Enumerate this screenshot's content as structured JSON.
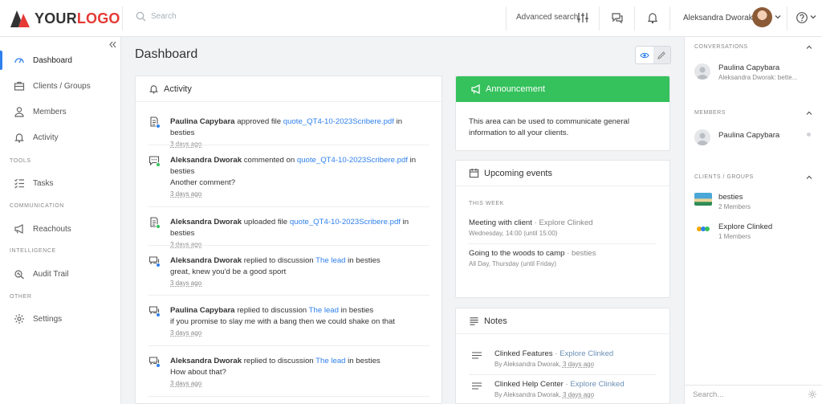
{
  "logo": {
    "part1": "YOUR",
    "part2": "LOGO"
  },
  "header": {
    "search_placeholder": "Search",
    "advanced_search": "Advanced search",
    "user_name": "Aleksandra Dworak"
  },
  "sidebar": {
    "items": [
      {
        "label": "Dashboard",
        "icon": "speedometer-icon"
      },
      {
        "label": "Clients / Groups",
        "icon": "briefcase-icon"
      },
      {
        "label": "Members",
        "icon": "user-icon"
      },
      {
        "label": "Activity",
        "icon": "bell-icon"
      },
      {
        "label": "Tasks",
        "icon": "checklist-icon"
      },
      {
        "label": "Reachouts",
        "icon": "megaphone-icon"
      },
      {
        "label": "Audit Trail",
        "icon": "audit-icon"
      },
      {
        "label": "Settings",
        "icon": "gear-icon"
      }
    ],
    "sections": [
      "TOOLS",
      "COMMUNICATION",
      "INTELLIGENCE",
      "OTHER"
    ]
  },
  "main": {
    "title": "Dashboard",
    "activity": {
      "title": "Activity",
      "items": [
        {
          "actor": "Paulina Capybara",
          "verb": "approved file",
          "target": "quote_QT4-10-2023Scribere.pdf",
          "suffix": "in besties",
          "body": "",
          "when": "3 days ago",
          "dot": "#2f80ed"
        },
        {
          "actor": "Aleksandra Dworak",
          "verb": "commented on",
          "target": "quote_QT4-10-2023Scribere.pdf",
          "suffix": "in besties",
          "body": "Another comment?",
          "when": "3 days ago",
          "dot": "#35c15c"
        },
        {
          "actor": "Aleksandra Dworak",
          "verb": "uploaded file",
          "target": "quote_QT4-10-2023Scribere.pdf",
          "suffix": "in besties",
          "body": "",
          "when": "3 days ago",
          "dot": "#35c15c"
        },
        {
          "actor": "Aleksandra Dworak",
          "verb": "replied to discussion",
          "target": "The lead",
          "suffix": "in besties",
          "body": "great, knew you'd be a good sport",
          "when": "3 days ago",
          "dot": "#2f80ed"
        },
        {
          "actor": "Paulina Capybara",
          "verb": "replied to discussion",
          "target": "The lead",
          "suffix": "in besties",
          "body": "if you promise to slay me with a bang then we could shake on that",
          "when": "3 days ago",
          "dot": "#2f80ed"
        },
        {
          "actor": "Aleksandra Dworak",
          "verb": "replied to discussion",
          "target": "The lead",
          "suffix": "in besties",
          "body": "How about that?",
          "when": "3 days ago",
          "dot": "#2f80ed"
        }
      ]
    },
    "announcement": {
      "title": "Announcement",
      "text": "This area can be used to communicate general information to all your clients."
    },
    "events": {
      "title": "Upcoming events",
      "week_label": "THIS WEEK",
      "items": [
        {
          "name": "Meeting with client",
          "group": "Explore Clinked",
          "time": "Wednesday, 14:00 (until 15:00)"
        },
        {
          "name": "Going to the woods to camp",
          "group": "besties",
          "time": "All Day, Thursday (until Friday)"
        }
      ]
    },
    "notes": {
      "title": "Notes",
      "items": [
        {
          "name": "Clinked Features",
          "group": "Explore Clinked",
          "by": "By Aleksandra Dworak,",
          "when": "3 days ago"
        },
        {
          "name": "Clinked Help Center",
          "group": "Explore Clinked",
          "by": "By Aleksandra Dworak,",
          "when": "3 days ago"
        }
      ]
    }
  },
  "right_panel": {
    "conversations": {
      "label": "CONVERSATIONS",
      "items": [
        {
          "name": "Paulina Capybara",
          "sub": "Aleksandra Dworak: bette..."
        }
      ]
    },
    "members": {
      "label": "MEMBERS",
      "items": [
        {
          "name": "Paulina Capybara"
        }
      ]
    },
    "groups": {
      "label": "CLIENTS / GROUPS",
      "items": [
        {
          "name": "besties",
          "sub": "2 Members"
        },
        {
          "name": "Explore Clinked",
          "sub": "1 Members"
        }
      ]
    },
    "search_placeholder": "Search..."
  },
  "colors": {
    "accent": "#2f80ed",
    "announcement": "#35c15c",
    "logo_red": "#e53935"
  }
}
